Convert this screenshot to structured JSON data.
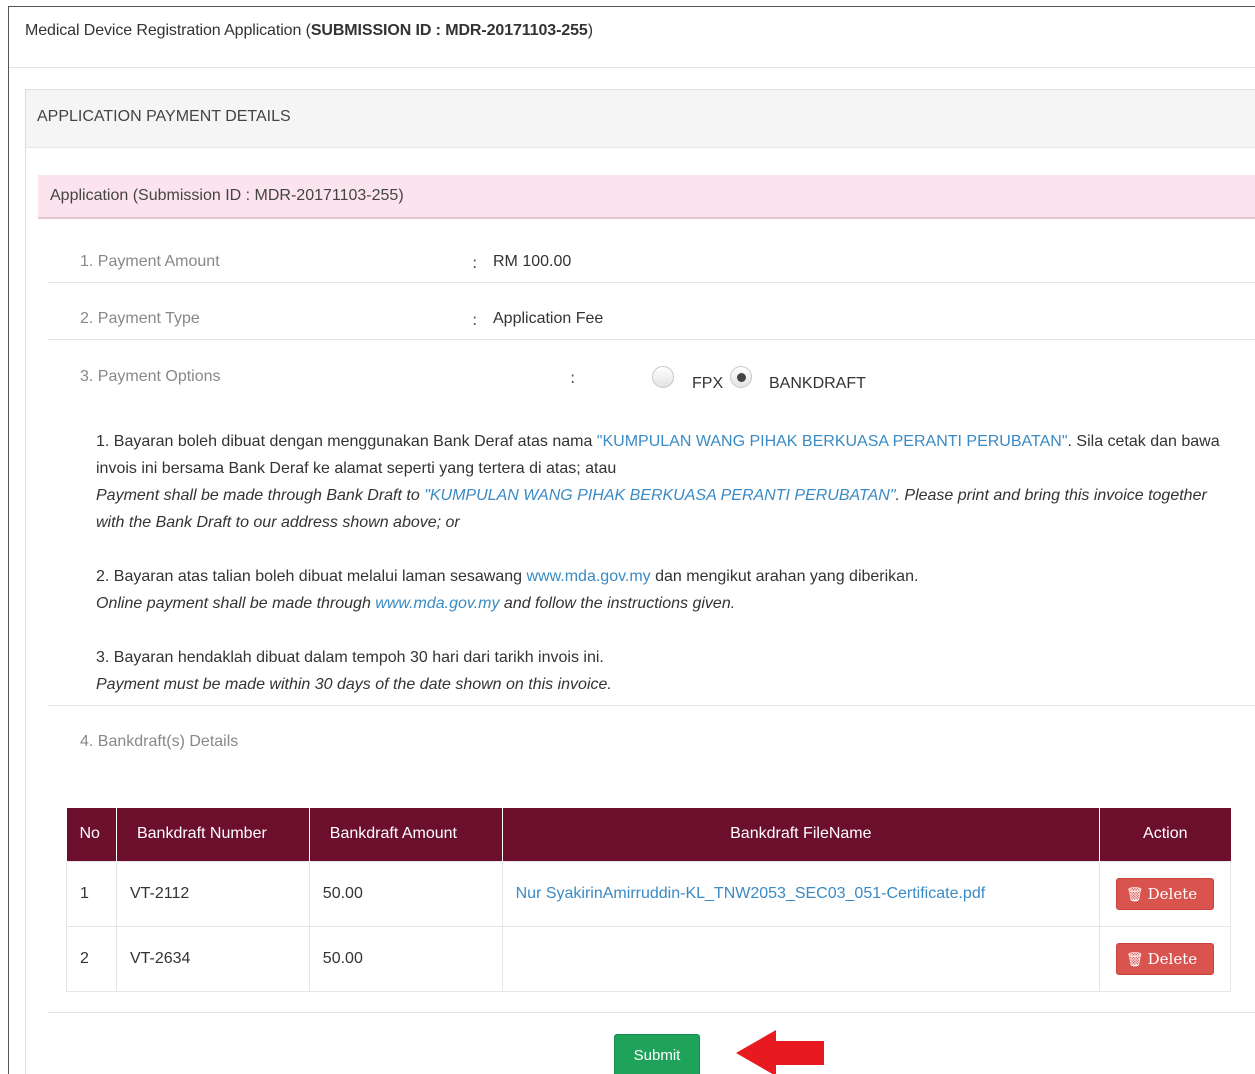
{
  "page": {
    "title_prefix": "Medical Device Registration Application (",
    "title_submission": "SUBMISSION ID : MDR-20171103-255",
    "title_suffix": ")"
  },
  "panel": {
    "heading": "APPLICATION PAYMENT DETAILS",
    "application_bar": "Application (Submission ID : MDR-20171103-255)"
  },
  "fields": {
    "amount": {
      "label": "1. Payment Amount",
      "value": "RM 100.00"
    },
    "type": {
      "label": "2. Payment Type",
      "value": "Application Fee"
    },
    "options": {
      "label": "3. Payment Options",
      "choices": [
        {
          "label": "FPX",
          "checked": false
        },
        {
          "label": "BANKDRAFT",
          "checked": true
        }
      ]
    },
    "bankdraft": {
      "label": "4. Bankdraft(s) Details"
    },
    "colon": ":"
  },
  "notes": {
    "n1_malay_a": "1. Bayaran boleh dibuat dengan menggunakan Bank Deraf atas nama ",
    "n1_malay_link": "\"KUMPULAN WANG PIHAK BERKUASA PERANTI PERUBATAN\"",
    "n1_malay_b": ". Sila cetak dan bawa invois ini bersama Bank Deraf ke alamat seperti yang tertera di atas; atau",
    "n1_eng_a": "Payment shall be made through Bank Draft to ",
    "n1_eng_link": "\"KUMPULAN WANG PIHAK BERKUASA PERANTI PERUBATAN\"",
    "n1_eng_b": ". Please print and bring this invoice together with the Bank Draft to our address shown above; or",
    "n2_malay_a": "2. Bayaran atas talian boleh dibuat melalui laman sesawang ",
    "n2_malay_link": "www.mda.gov.my",
    "n2_malay_b": " dan mengikut arahan yang diberikan.",
    "n2_eng_a": "Online payment shall be made through ",
    "n2_eng_link": "www.mda.gov.my",
    "n2_eng_b": " and follow the instructions given.",
    "n3_malay": "3. Bayaran hendaklah dibuat dalam tempoh 30 hari dari tarikh invois ini.",
    "n3_eng": "Payment must be made within 30 days of the date shown on this invoice."
  },
  "table": {
    "headers": [
      "No",
      "Bankdraft Number",
      "Bankdraft Amount",
      "Bankdraft FileName",
      "Action"
    ],
    "rows": [
      {
        "no": "1",
        "number": "VT-2112",
        "amount": "50.00",
        "file": "Nur SyakirinAmirruddin-KL_TNW2053_SEC03_051-Certificate.pdf",
        "action": "Delete"
      },
      {
        "no": "2",
        "number": "VT-2634",
        "amount": "50.00",
        "file": "",
        "action": "Delete"
      }
    ]
  },
  "submit_label": "Submit",
  "colors": {
    "table_header": "#6b0f2d",
    "submit": "#1fa25a",
    "delete": "#d9534f",
    "link": "#3a8ac4",
    "arrow": "#e8191f"
  }
}
